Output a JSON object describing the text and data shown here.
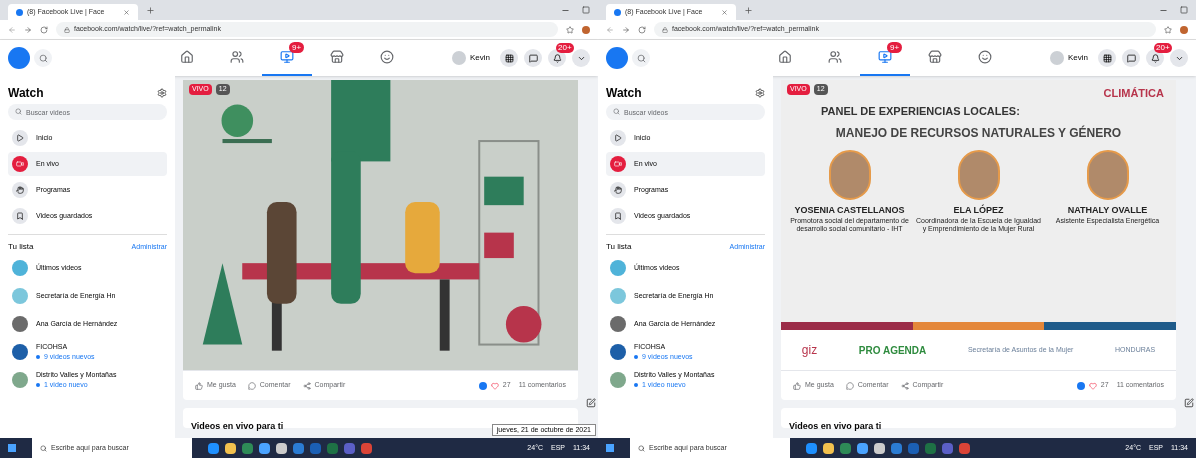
{
  "panes": [
    {
      "browser": {
        "tab_title": "(8) Facebook Live | Face",
        "url": "facebook.com/watch/live/?ref=watch_permalink"
      },
      "header": {
        "nav": [
          {
            "kind": "home",
            "selected": false
          },
          {
            "kind": "friends",
            "selected": false
          },
          {
            "kind": "watch",
            "selected": true,
            "badge": "9+"
          },
          {
            "kind": "marketplace",
            "selected": false
          },
          {
            "kind": "groups",
            "selected": false
          }
        ],
        "profile": "Kevin",
        "notifications_badge": "20+"
      },
      "sidebar": {
        "title": "Watch",
        "search_placeholder": "Buscar videos",
        "nav": [
          {
            "kind": "home",
            "label": "Inicio",
            "selected": false
          },
          {
            "kind": "live",
            "label": "En vivo",
            "selected": true
          },
          {
            "kind": "shows",
            "label": "Programas",
            "selected": false
          },
          {
            "kind": "saved",
            "label": "Videos guardados",
            "selected": false
          }
        ],
        "list_title": "Tu lista",
        "list_action": "Administrar",
        "list": [
          {
            "label": "Últimos videos",
            "color": "#4fb3d9"
          },
          {
            "label": "Secretaría de Energía Hn",
            "color": "#7cc7dc"
          },
          {
            "label": "Ana García de Hernández",
            "color": "#6b6b6b"
          },
          {
            "label": "FICOHSA",
            "color": "#1d5fa8",
            "sub": "9 videos nuevos"
          },
          {
            "label": "Distrito Valles y Montañas",
            "color": "#7fa88c",
            "sub": "1 video nuevo"
          }
        ]
      },
      "video": {
        "kind": "illustration",
        "live_badge": "VIVO",
        "viewers": "12"
      },
      "actions": [
        "Me gusta",
        "Comentar",
        "Compartir"
      ],
      "reactions": "27",
      "comments": "11 comentarios",
      "section_title": "Videos en vivo para ti",
      "tooltip": "jueves, 21 de octubre de 2021",
      "taskbar": {
        "search_placeholder": "Escribe aquí para buscar",
        "weather": "24°C",
        "language": "ESP",
        "time": "11:34"
      }
    },
    {
      "browser": {
        "tab_title": "(8) Facebook Live | Face",
        "url": "facebook.com/watch/live/?ref=watch_permalink"
      },
      "header": {
        "nav": [
          {
            "kind": "home",
            "selected": false
          },
          {
            "kind": "friends",
            "selected": false
          },
          {
            "kind": "watch",
            "selected": true,
            "badge": "9+"
          },
          {
            "kind": "marketplace",
            "selected": false
          },
          {
            "kind": "groups",
            "selected": false
          }
        ],
        "profile": "Kevin",
        "notifications_badge": "20+"
      },
      "sidebar": {
        "title": "Watch",
        "search_placeholder": "Buscar videos",
        "nav": [
          {
            "kind": "home",
            "label": "Inicio",
            "selected": false
          },
          {
            "kind": "live",
            "label": "En vivo",
            "selected": true
          },
          {
            "kind": "shows",
            "label": "Programas",
            "selected": false
          },
          {
            "kind": "saved",
            "label": "Videos guardados",
            "selected": false
          }
        ],
        "list_title": "Tu lista",
        "list_action": "Administrar",
        "list": [
          {
            "label": "Últimos videos",
            "color": "#4fb3d9"
          },
          {
            "label": "Secretaría de Energía Hn",
            "color": "#7cc7dc"
          },
          {
            "label": "Ana García de Hernández",
            "color": "#6b6b6b"
          },
          {
            "label": "FICOHSA",
            "color": "#1d5fa8",
            "sub": "9 videos nuevos"
          },
          {
            "label": "Distrito Valles y Montañas",
            "color": "#7fa88c",
            "sub": "1 video nuevo"
          }
        ]
      },
      "video": {
        "kind": "event_panel",
        "live_badge": "VIVO",
        "viewers": "12",
        "logo": "CLIMÁTICA",
        "heading": "PANEL DE EXPERIENCIAS LOCALES:",
        "subheading": "MANEJO DE RECURSOS NATURALES Y GÉNERO",
        "speakers": [
          {
            "name": "YOSENIA CASTELLANOS",
            "role": "Promotora social del departamento de desarrollo social comunitario - IHT"
          },
          {
            "name": "ELA LÓPEZ",
            "role": "Coordinadora de la Escuela de Igualdad y Emprendimiento de la Mujer Rural"
          },
          {
            "name": "NATHALY OVALLE",
            "role": "Asistente Especialista Energética"
          }
        ],
        "sponsors": [
          "giz",
          "PRO AGENDA",
          "Secretaría de Asuntos de la Mujer",
          "HONDURAS"
        ]
      },
      "actions": [
        "Me gusta",
        "Comentar",
        "Compartir"
      ],
      "reactions": "27",
      "comments": "11 comentarios",
      "section_title": "Videos en vivo para ti",
      "taskbar": {
        "search_placeholder": "Escribe aquí para buscar",
        "weather": "24°C",
        "language": "ESP",
        "time": "11:34"
      }
    }
  ]
}
